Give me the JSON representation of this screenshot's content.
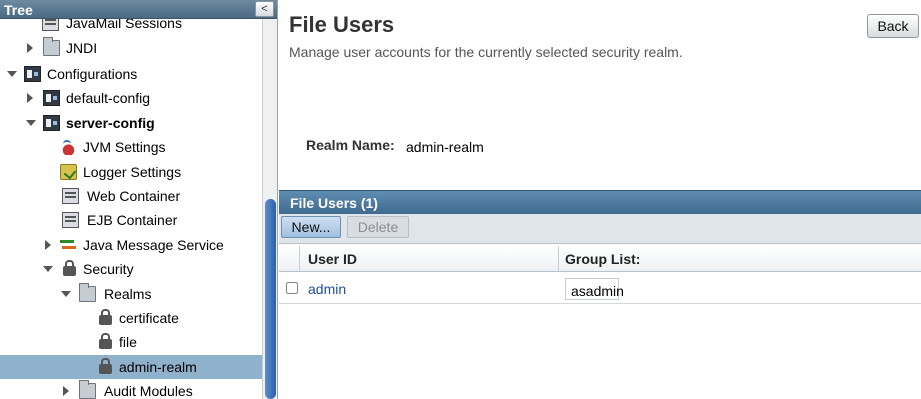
{
  "tree": {
    "title": "Tree",
    "collapse_glyph": "<",
    "items": [
      {
        "label": "JavaMail Sessions",
        "icon": "server-icon"
      },
      {
        "label": "JNDI",
        "icon": "folder-icon"
      },
      {
        "label": "Configurations",
        "icon": "config-icon"
      },
      {
        "label": "default-config",
        "icon": "config-icon"
      },
      {
        "label": "server-config",
        "icon": "config-icon"
      },
      {
        "label": "JVM Settings",
        "icon": "java-icon"
      },
      {
        "label": "Logger Settings",
        "icon": "logger-icon"
      },
      {
        "label": "Web Container",
        "icon": "server-icon"
      },
      {
        "label": "EJB Container",
        "icon": "server-icon"
      },
      {
        "label": "Java Message Service",
        "icon": "jms-icon"
      },
      {
        "label": "Security",
        "icon": "lock-icon"
      },
      {
        "label": "Realms",
        "icon": "folder-icon"
      },
      {
        "label": "certificate",
        "icon": "lock-icon"
      },
      {
        "label": "file",
        "icon": "lock-icon"
      },
      {
        "label": "admin-realm",
        "icon": "lock-icon"
      },
      {
        "label": "Audit Modules",
        "icon": "folder-icon"
      }
    ]
  },
  "page": {
    "title": "File Users",
    "help": "Manage user accounts for the currently selected security realm.",
    "back_label": "Back",
    "realm_label": "Realm Name:",
    "realm_value": "admin-realm"
  },
  "table": {
    "title": "File Users (1)",
    "new_label": "New...",
    "delete_label": "Delete",
    "columns": [
      "User ID",
      "Group List:"
    ],
    "rows": [
      {
        "user_id": "admin",
        "group_list": "asadmin"
      }
    ]
  },
  "colors": {
    "header_bar": "#4a6a84",
    "selected_row": "#8fb1cc",
    "link": "#1f4e9a"
  }
}
